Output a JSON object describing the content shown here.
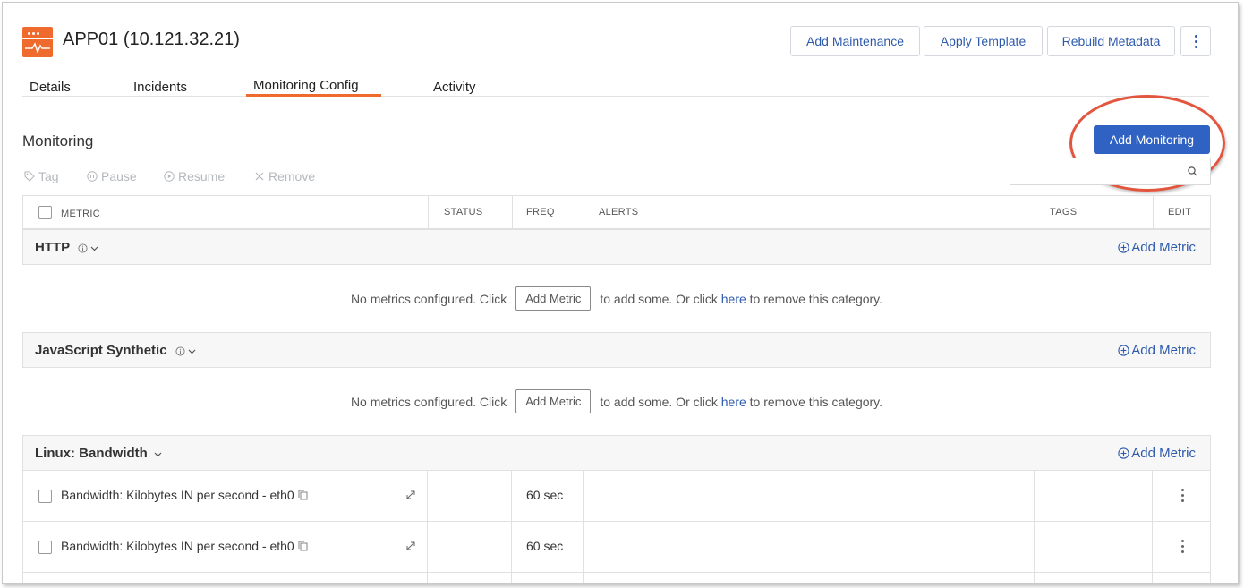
{
  "header": {
    "title": "APP01 (10.121.32.21)",
    "device_icon": "server-icon",
    "buttons": {
      "add_maintenance": "Add Maintenance",
      "apply_template": "Apply Template",
      "rebuild_metadata": "Rebuild Metadata"
    }
  },
  "tabs": [
    {
      "label": "Details"
    },
    {
      "label": "Incidents"
    },
    {
      "label": "Monitoring Config",
      "active": true
    },
    {
      "label": "Activity"
    }
  ],
  "monitoring": {
    "title": "Monitoring",
    "add_button": "Add Monitoring",
    "toolbar": {
      "tag": "Tag",
      "pause": "Pause",
      "resume": "Resume",
      "remove": "Remove"
    },
    "search": {
      "value": "",
      "placeholder": ""
    }
  },
  "table": {
    "columns": {
      "metric": "METRIC",
      "status": "STATUS",
      "freq": "FREQ",
      "alerts": "ALERTS",
      "tags": "TAGS",
      "edit": "EDIT"
    },
    "add_metric_link": "Add Metric",
    "empty": {
      "prefix": "No metrics configured. Click",
      "button": "Add Metric",
      "middle": "to add some. Or click",
      "link": "here",
      "suffix": "to remove this category."
    },
    "categories": [
      {
        "name": "HTTP"
      },
      {
        "name": "JavaScript Synthetic"
      },
      {
        "name": "Linux: Bandwidth"
      }
    ],
    "metrics": [
      {
        "name": "Bandwidth: Kilobytes IN per second - eth0",
        "freq": "60 sec"
      },
      {
        "name": "Bandwidth: Kilobytes IN per second - eth0",
        "freq": "60 sec"
      }
    ]
  },
  "colors": {
    "accent": "#ee6b2d",
    "primary": "#2f62c2",
    "link": "#2e5aac",
    "highlight": "#e2553e"
  }
}
